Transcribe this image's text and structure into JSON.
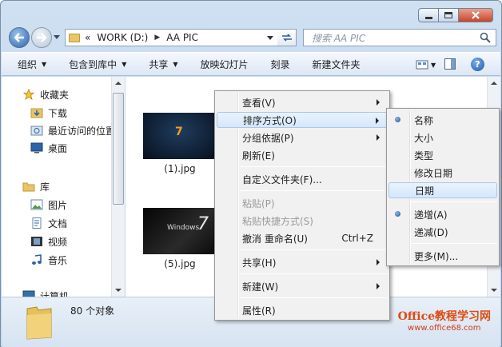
{
  "window": {
    "address": {
      "root": "«",
      "crumbs": [
        "WORK (D:)",
        "AA PIC"
      ]
    },
    "search_placeholder": "搜索 AA PIC"
  },
  "toolbar": {
    "items": [
      "组织",
      "包含到库中",
      "共享",
      "放映幻灯片",
      "刻录",
      "新建文件夹"
    ],
    "dropdown_arrow": "▼"
  },
  "nav": {
    "items": [
      {
        "label": "收藏夹",
        "icon": "star-icon"
      },
      {
        "label": "下载",
        "icon": "download-folder-icon"
      },
      {
        "label": "最近访问的位置",
        "icon": "recent-places-icon"
      },
      {
        "label": "桌面",
        "icon": "desktop-icon"
      },
      {
        "label": "库",
        "icon": "library-icon"
      },
      {
        "label": "图片",
        "icon": "pictures-icon"
      },
      {
        "label": "文档",
        "icon": "documents-icon"
      },
      {
        "label": "视频",
        "icon": "videos-icon"
      },
      {
        "label": "音乐",
        "icon": "music-icon"
      },
      {
        "label": "计算机",
        "icon": "computer-icon"
      }
    ]
  },
  "files": [
    {
      "name": "(1).jpg"
    },
    {
      "name": "(5).jpg"
    }
  ],
  "thumb_text": {
    "seven": "7",
    "windows": "Windows"
  },
  "status": {
    "count": "80 个对象"
  },
  "watermark": {
    "line1": "Office教程学习网",
    "line2": "www.office68.com"
  },
  "context_menu": {
    "items": [
      {
        "label": "查看(V)",
        "submenu": true
      },
      {
        "label": "排序方式(O)",
        "submenu": true,
        "highlighted": true
      },
      {
        "label": "分组依据(P)",
        "submenu": true
      },
      {
        "label": "刷新(E)"
      },
      {
        "label": "自定义文件夹(F)..."
      },
      {
        "label": "粘贴(P)",
        "disabled": true
      },
      {
        "label": "粘贴快捷方式(S)",
        "disabled": true
      },
      {
        "label": "撤消 重命名(U)",
        "shortcut": "Ctrl+Z"
      },
      {
        "label": "共享(H)",
        "submenu": true
      },
      {
        "label": "新建(W)",
        "submenu": true
      },
      {
        "label": "属性(R)"
      }
    ]
  },
  "sort_submenu": {
    "items": [
      {
        "label": "名称",
        "selected": true
      },
      {
        "label": "大小"
      },
      {
        "label": "类型"
      },
      {
        "label": "修改日期"
      },
      {
        "label": "日期",
        "highlighted": true
      },
      {
        "label": "递增(A)",
        "selected": true
      },
      {
        "label": "递减(D)"
      },
      {
        "label": "更多(M)..."
      }
    ]
  }
}
